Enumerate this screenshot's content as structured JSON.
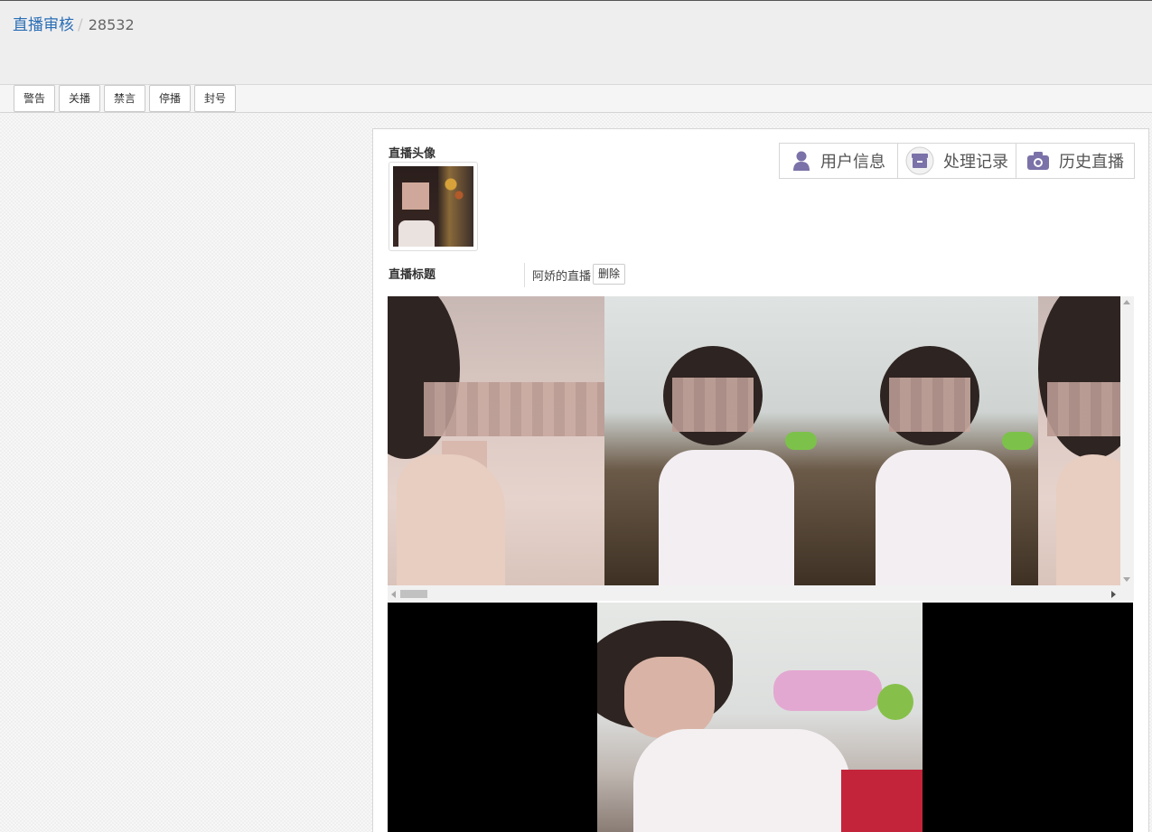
{
  "breadcrumb": {
    "section": "直播审核",
    "separator": "/",
    "current": "28532"
  },
  "toolbar": {
    "buttons": [
      "警告",
      "关播",
      "禁言",
      "停播",
      "封号"
    ]
  },
  "detail": {
    "avatar_label": "直播头像",
    "title_label": "直播标题",
    "title_value": "阿娇的直播",
    "delete_label": "删除"
  },
  "tabs": [
    {
      "label": "用户信息",
      "icon": "user-icon"
    },
    {
      "label": "处理记录",
      "icon": "archive-icon"
    },
    {
      "label": "历史直播",
      "icon": "camera-icon"
    }
  ],
  "colors": {
    "link": "#2a6fb5",
    "tab_icon": "#7a72a8"
  }
}
